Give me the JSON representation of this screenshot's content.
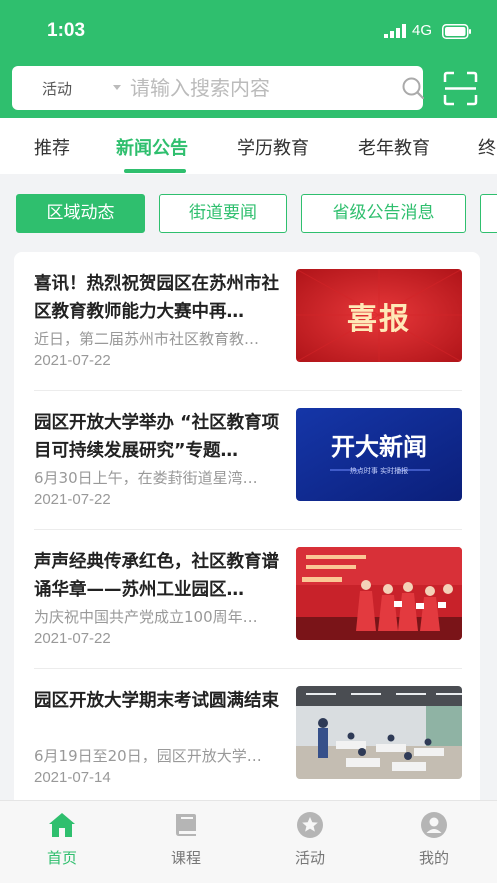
{
  "status_bar": {
    "time": "1:03",
    "network": "4G"
  },
  "search": {
    "category": "活动",
    "placeholder": "请输入搜索内容"
  },
  "tabs": [
    {
      "label": "推荐"
    },
    {
      "label": "新闻公告"
    },
    {
      "label": "学历教育"
    },
    {
      "label": "老年教育"
    },
    {
      "label": "终"
    }
  ],
  "active_tab": "新闻公告",
  "filters": [
    {
      "label": "区域动态"
    },
    {
      "label": "街道要闻"
    },
    {
      "label": "省级公告消息"
    }
  ],
  "news": [
    {
      "title": "喜讯！热烈祝贺园区在苏州市社区教育教师能力大赛中再…",
      "summary": "近日，第二届苏州市社区教育教…",
      "date": "2021-07-22",
      "thumb_text": "喜报"
    },
    {
      "title": "园区开放大学举办 “社区教育项目可持续发展研究”专题…",
      "summary": "6月30日上午，在娄葑街道星湾…",
      "date": "2021-07-22",
      "thumb_text": "开大新闻",
      "thumb_subtext": "热点时事 实时播报"
    },
    {
      "title": "声声经典传承红色，社区教育谱诵华章——苏州工业园区…",
      "summary": "为庆祝中国共产党成立100周年…",
      "date": "2021-07-22"
    },
    {
      "title": "园区开放大学期末考试圆满结束",
      "summary": "6月19日至20日，园区开放大学…",
      "date": "2021-07-14"
    }
  ],
  "bottom_nav": [
    {
      "label": "首页",
      "icon": "home-icon"
    },
    {
      "label": "课程",
      "icon": "book-icon"
    },
    {
      "label": "活动",
      "icon": "star-icon"
    },
    {
      "label": "我的",
      "icon": "user-icon"
    }
  ],
  "colors": {
    "accent": "#2fbf6e",
    "inactive": "#b5b5b5"
  }
}
